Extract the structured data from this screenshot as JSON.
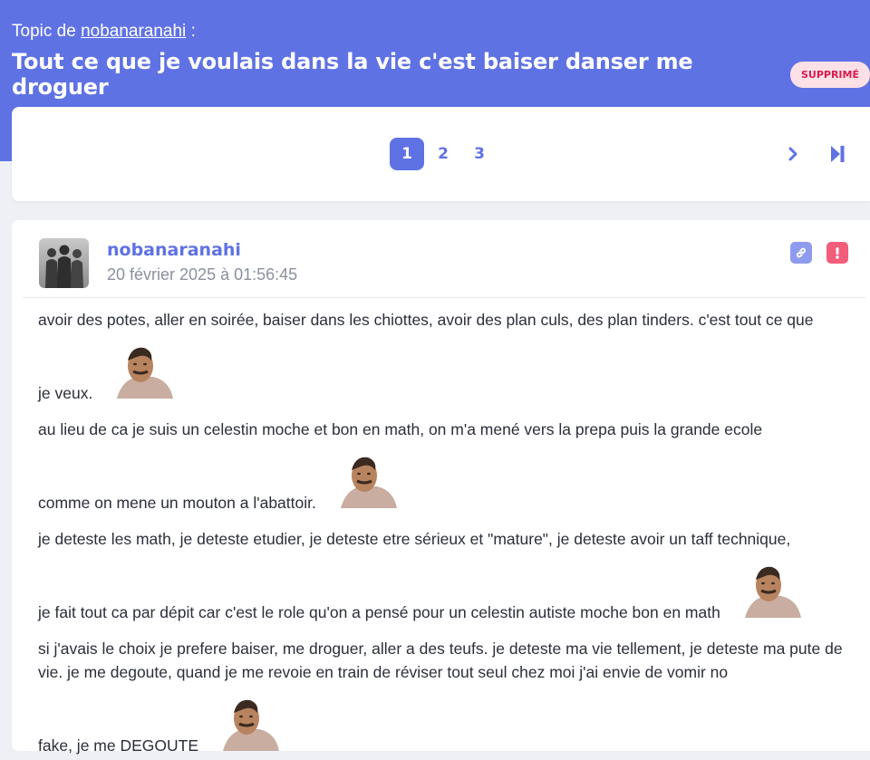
{
  "header": {
    "topic_prefix": "Topic de",
    "topic_author": "nobanaranahi",
    "topic_suffix": ":",
    "title": "Tout ce que je voulais dans la vie c'est baiser danser me droguer",
    "badge": "SUPPRIMÉ"
  },
  "pagination": {
    "pages": [
      "1",
      "2",
      "3"
    ],
    "current": "1",
    "next_icon": "chevron-right-icon",
    "last_icon": "skip-to-end-icon"
  },
  "post": {
    "author": "nobanaranahi",
    "date": "20 février 2025 à 01:56:45",
    "avatar_icon": "avatar-silhouettes",
    "actions": {
      "link_icon": "link-icon",
      "report_icon": "report-icon"
    },
    "paragraphs": [
      {
        "text": "avoir des potes, aller en soirée, baiser dans les chiottes, avoir des plan culs, des plan tinders. c'est tout ce que",
        "tail": "je veux."
      },
      {
        "text": "au lieu de ca je suis un celestin moche et bon en math, on m'a mené vers la prepa puis la grande ecole",
        "tail": "comme on mene un mouton a l'abattoir."
      },
      {
        "text": "je deteste les math, je deteste etudier, je deteste etre sérieux et \"mature\", je deteste avoir un taff technique,",
        "tail": "je fait tout ca par dépit car c'est le role qu'on a pensé pour un celestin autiste moche bon en math"
      },
      {
        "text": "si j'avais le choix je prefere baiser, me droguer, aller a des teufs. je deteste ma vie tellement, je deteste ma pute de vie. je me degoute, quand je me revoie en train de réviser tout seul chez moi j'ai envie de vomir no",
        "tail": "fake, je me DEGOUTE"
      }
    ],
    "sticker_name": "risitas-sticker"
  },
  "colors": {
    "accent": "#5f72e4",
    "badge_bg": "#fde1e7",
    "badge_text": "#d81b4d",
    "report": "#f25d7b"
  }
}
